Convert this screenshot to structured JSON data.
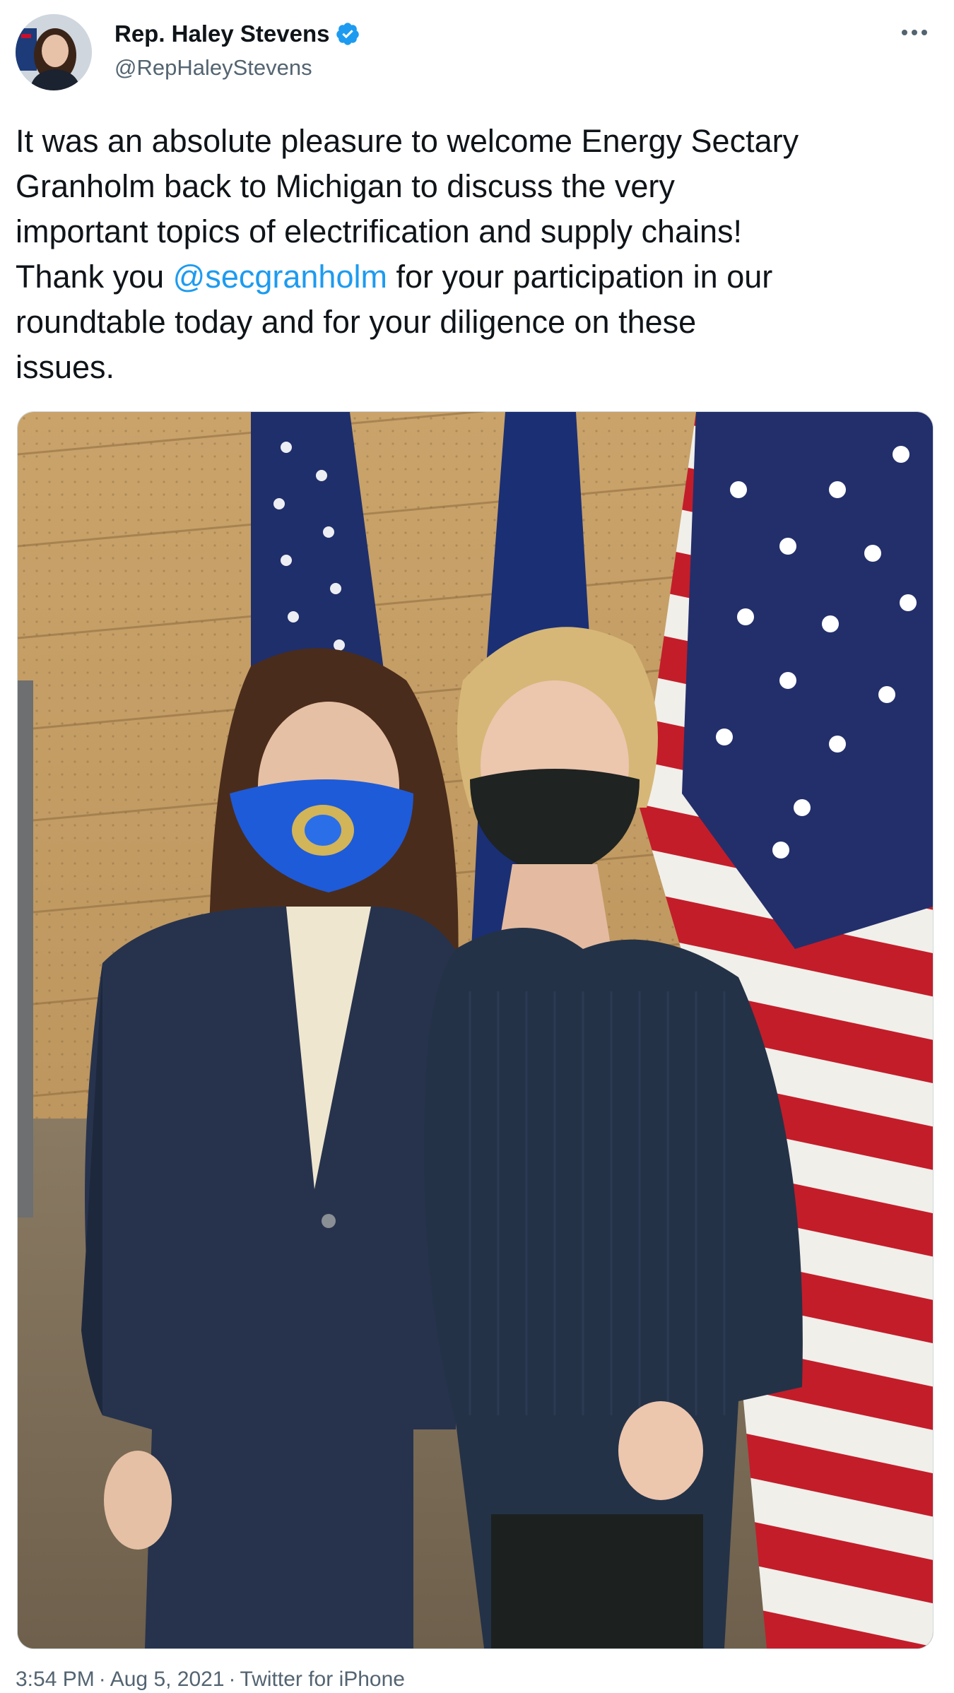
{
  "author": {
    "name": "Rep. Haley Stevens",
    "handle": "@RepHaleyStevens",
    "verified": true,
    "avatar_icon": "profile-photo"
  },
  "menu": {
    "icon": "more-dots-icon"
  },
  "tweet": {
    "text_before": "It was an absolute pleasure to welcome Energy Sectary\nGranholm back to Michigan to discuss the very\nimportant topics of electrification and supply chains!\nThank you ",
    "mention": "@secgranholm",
    "text_after": " for your participation in our\nroundtable today and for your diligence on these\nissues."
  },
  "meta": {
    "time": "3:54 PM",
    "date": "Aug 5, 2021",
    "source": "Twitter for iPhone",
    "separator": "·"
  },
  "colors": {
    "link": "#1d9bf0",
    "secondary_text": "#536471",
    "verified_badge": "#1d9bf0"
  }
}
